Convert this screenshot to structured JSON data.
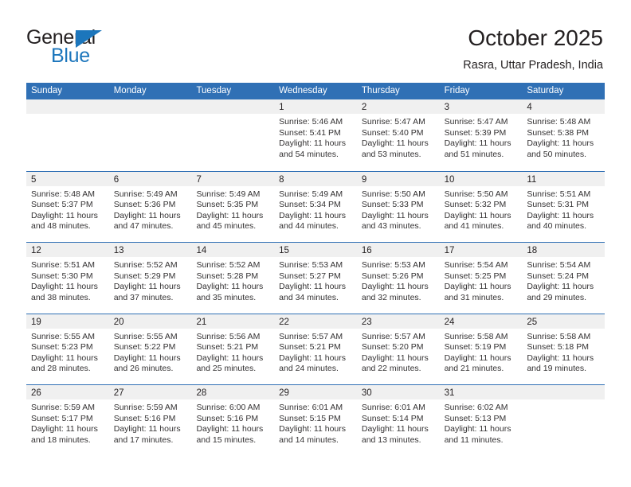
{
  "brand": {
    "name_top": "General",
    "name_bottom": "Blue",
    "triangle_color": "#1c76bc",
    "text_color": "#231f20"
  },
  "header": {
    "title": "October 2025",
    "location": "Rasra, Uttar Pradesh, India"
  },
  "theme": {
    "header_blue": "#3070b5",
    "daynum_band": "#f0f0f0",
    "text": "#231f20"
  },
  "calendar": {
    "weekday_headers": [
      "Sunday",
      "Monday",
      "Tuesday",
      "Wednesday",
      "Thursday",
      "Friday",
      "Saturday"
    ],
    "weeks": [
      [
        {
          "day": "",
          "lines": []
        },
        {
          "day": "",
          "lines": []
        },
        {
          "day": "",
          "lines": []
        },
        {
          "day": "1",
          "lines": [
            "Sunrise: 5:46 AM",
            "Sunset: 5:41 PM",
            "Daylight: 11 hours",
            "and 54 minutes."
          ]
        },
        {
          "day": "2",
          "lines": [
            "Sunrise: 5:47 AM",
            "Sunset: 5:40 PM",
            "Daylight: 11 hours",
            "and 53 minutes."
          ]
        },
        {
          "day": "3",
          "lines": [
            "Sunrise: 5:47 AM",
            "Sunset: 5:39 PM",
            "Daylight: 11 hours",
            "and 51 minutes."
          ]
        },
        {
          "day": "4",
          "lines": [
            "Sunrise: 5:48 AM",
            "Sunset: 5:38 PM",
            "Daylight: 11 hours",
            "and 50 minutes."
          ]
        }
      ],
      [
        {
          "day": "5",
          "lines": [
            "Sunrise: 5:48 AM",
            "Sunset: 5:37 PM",
            "Daylight: 11 hours",
            "and 48 minutes."
          ]
        },
        {
          "day": "6",
          "lines": [
            "Sunrise: 5:49 AM",
            "Sunset: 5:36 PM",
            "Daylight: 11 hours",
            "and 47 minutes."
          ]
        },
        {
          "day": "7",
          "lines": [
            "Sunrise: 5:49 AM",
            "Sunset: 5:35 PM",
            "Daylight: 11 hours",
            "and 45 minutes."
          ]
        },
        {
          "day": "8",
          "lines": [
            "Sunrise: 5:49 AM",
            "Sunset: 5:34 PM",
            "Daylight: 11 hours",
            "and 44 minutes."
          ]
        },
        {
          "day": "9",
          "lines": [
            "Sunrise: 5:50 AM",
            "Sunset: 5:33 PM",
            "Daylight: 11 hours",
            "and 43 minutes."
          ]
        },
        {
          "day": "10",
          "lines": [
            "Sunrise: 5:50 AM",
            "Sunset: 5:32 PM",
            "Daylight: 11 hours",
            "and 41 minutes."
          ]
        },
        {
          "day": "11",
          "lines": [
            "Sunrise: 5:51 AM",
            "Sunset: 5:31 PM",
            "Daylight: 11 hours",
            "and 40 minutes."
          ]
        }
      ],
      [
        {
          "day": "12",
          "lines": [
            "Sunrise: 5:51 AM",
            "Sunset: 5:30 PM",
            "Daylight: 11 hours",
            "and 38 minutes."
          ]
        },
        {
          "day": "13",
          "lines": [
            "Sunrise: 5:52 AM",
            "Sunset: 5:29 PM",
            "Daylight: 11 hours",
            "and 37 minutes."
          ]
        },
        {
          "day": "14",
          "lines": [
            "Sunrise: 5:52 AM",
            "Sunset: 5:28 PM",
            "Daylight: 11 hours",
            "and 35 minutes."
          ]
        },
        {
          "day": "15",
          "lines": [
            "Sunrise: 5:53 AM",
            "Sunset: 5:27 PM",
            "Daylight: 11 hours",
            "and 34 minutes."
          ]
        },
        {
          "day": "16",
          "lines": [
            "Sunrise: 5:53 AM",
            "Sunset: 5:26 PM",
            "Daylight: 11 hours",
            "and 32 minutes."
          ]
        },
        {
          "day": "17",
          "lines": [
            "Sunrise: 5:54 AM",
            "Sunset: 5:25 PM",
            "Daylight: 11 hours",
            "and 31 minutes."
          ]
        },
        {
          "day": "18",
          "lines": [
            "Sunrise: 5:54 AM",
            "Sunset: 5:24 PM",
            "Daylight: 11 hours",
            "and 29 minutes."
          ]
        }
      ],
      [
        {
          "day": "19",
          "lines": [
            "Sunrise: 5:55 AM",
            "Sunset: 5:23 PM",
            "Daylight: 11 hours",
            "and 28 minutes."
          ]
        },
        {
          "day": "20",
          "lines": [
            "Sunrise: 5:55 AM",
            "Sunset: 5:22 PM",
            "Daylight: 11 hours",
            "and 26 minutes."
          ]
        },
        {
          "day": "21",
          "lines": [
            "Sunrise: 5:56 AM",
            "Sunset: 5:21 PM",
            "Daylight: 11 hours",
            "and 25 minutes."
          ]
        },
        {
          "day": "22",
          "lines": [
            "Sunrise: 5:57 AM",
            "Sunset: 5:21 PM",
            "Daylight: 11 hours",
            "and 24 minutes."
          ]
        },
        {
          "day": "23",
          "lines": [
            "Sunrise: 5:57 AM",
            "Sunset: 5:20 PM",
            "Daylight: 11 hours",
            "and 22 minutes."
          ]
        },
        {
          "day": "24",
          "lines": [
            "Sunrise: 5:58 AM",
            "Sunset: 5:19 PM",
            "Daylight: 11 hours",
            "and 21 minutes."
          ]
        },
        {
          "day": "25",
          "lines": [
            "Sunrise: 5:58 AM",
            "Sunset: 5:18 PM",
            "Daylight: 11 hours",
            "and 19 minutes."
          ]
        }
      ],
      [
        {
          "day": "26",
          "lines": [
            "Sunrise: 5:59 AM",
            "Sunset: 5:17 PM",
            "Daylight: 11 hours",
            "and 18 minutes."
          ]
        },
        {
          "day": "27",
          "lines": [
            "Sunrise: 5:59 AM",
            "Sunset: 5:16 PM",
            "Daylight: 11 hours",
            "and 17 minutes."
          ]
        },
        {
          "day": "28",
          "lines": [
            "Sunrise: 6:00 AM",
            "Sunset: 5:16 PM",
            "Daylight: 11 hours",
            "and 15 minutes."
          ]
        },
        {
          "day": "29",
          "lines": [
            "Sunrise: 6:01 AM",
            "Sunset: 5:15 PM",
            "Daylight: 11 hours",
            "and 14 minutes."
          ]
        },
        {
          "day": "30",
          "lines": [
            "Sunrise: 6:01 AM",
            "Sunset: 5:14 PM",
            "Daylight: 11 hours",
            "and 13 minutes."
          ]
        },
        {
          "day": "31",
          "lines": [
            "Sunrise: 6:02 AM",
            "Sunset: 5:13 PM",
            "Daylight: 11 hours",
            "and 11 minutes."
          ]
        },
        {
          "day": "",
          "lines": []
        }
      ]
    ]
  }
}
